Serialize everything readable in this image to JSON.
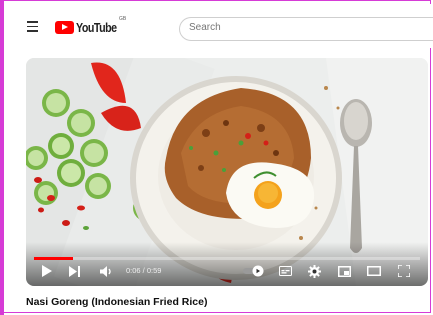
{
  "header": {
    "logo_text": "YouTube",
    "country_code": "GB",
    "search_placeholder": "Search"
  },
  "player": {
    "time_display": "0:06 / 0:59",
    "progress_fraction": 0.102
  },
  "video": {
    "title": "Nasi Goreng (Indonesian Fried Rice)"
  },
  "colors": {
    "brand_red": "#ff0000",
    "frame_border": "#d63bd6"
  },
  "icons": [
    "menu-icon",
    "youtube-logo-icon",
    "play-icon",
    "next-icon",
    "volume-icon",
    "autoplay-toggle-icon",
    "subtitles-icon",
    "settings-icon",
    "miniplayer-icon",
    "theater-icon",
    "fullscreen-icon"
  ]
}
